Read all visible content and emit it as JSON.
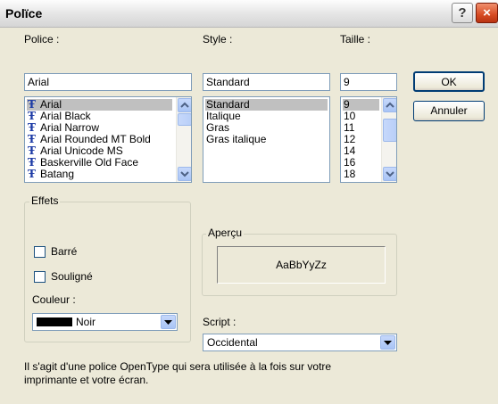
{
  "window": {
    "title": "Polïce",
    "help_label": "?",
    "close_label": "×"
  },
  "font_panel": {
    "label": "Police :",
    "value": "Arial",
    "items": [
      {
        "name": "Arial",
        "selected": true
      },
      {
        "name": "Arial Black",
        "selected": false
      },
      {
        "name": "Arial Narrow",
        "selected": false
      },
      {
        "name": "Arial Rounded MT Bold",
        "selected": false
      },
      {
        "name": "Arial Unicode MS",
        "selected": false
      },
      {
        "name": "Baskerville Old Face",
        "selected": false
      },
      {
        "name": "Batang",
        "selected": false
      }
    ]
  },
  "style_panel": {
    "label": "Style :",
    "value": "Standard",
    "items": [
      {
        "name": "Standard",
        "selected": true
      },
      {
        "name": "Italique",
        "selected": false
      },
      {
        "name": "Gras",
        "selected": false
      },
      {
        "name": "Gras italique",
        "selected": false
      }
    ]
  },
  "size_panel": {
    "label": "Taille :",
    "value": "9",
    "items": [
      {
        "name": "9",
        "selected": true
      },
      {
        "name": "10",
        "selected": false
      },
      {
        "name": "11",
        "selected": false
      },
      {
        "name": "12",
        "selected": false
      },
      {
        "name": "14",
        "selected": false
      },
      {
        "name": "16",
        "selected": false
      },
      {
        "name": "18",
        "selected": false
      }
    ]
  },
  "buttons": {
    "ok": "OK",
    "cancel": "Annuler"
  },
  "effects": {
    "title": "Effets",
    "strike": "Barré",
    "underline": "Souligné",
    "color_label": "Couleur :",
    "color_value": "Noir",
    "color_swatch": "#000000"
  },
  "preview": {
    "title": "Aperçu",
    "sample": "AaBbYyZz"
  },
  "script": {
    "label": "Script :",
    "value": "Occidental"
  },
  "description": "Il s'agit d'une police OpenType qui sera utilisée à la fois sur votre imprimante et votre écran."
}
